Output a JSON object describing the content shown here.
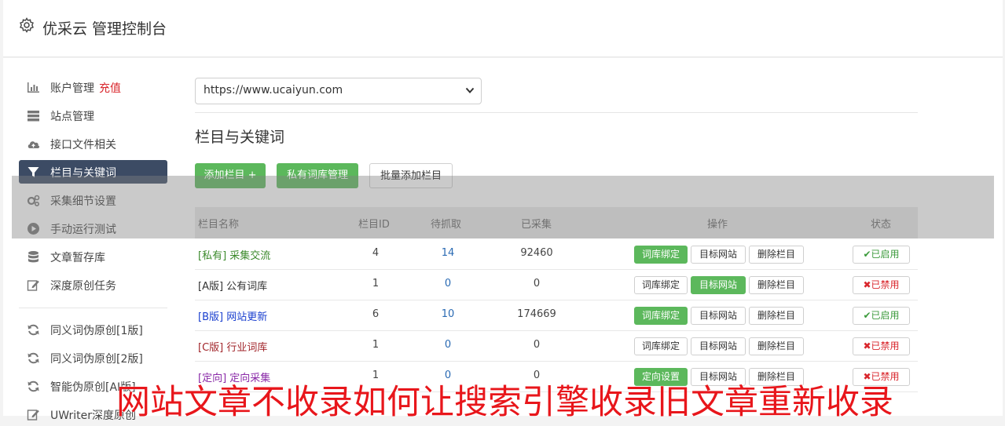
{
  "header": {
    "title": "优采云 管理控制台"
  },
  "sidebar": {
    "items": [
      {
        "label": "账户管理",
        "extra": "充值",
        "icon": "bar-chart-icon"
      },
      {
        "label": "站点管理",
        "icon": "server-icon"
      },
      {
        "label": "接口文件相关",
        "icon": "cloud-upload-icon"
      },
      {
        "label": "栏目与关键词",
        "icon": "filter-icon",
        "active": true
      },
      {
        "label": "采集细节设置",
        "icon": "cogs-icon"
      },
      {
        "label": "手动运行测试",
        "icon": "play-circle-icon"
      },
      {
        "label": "文章暂存库",
        "icon": "database-icon"
      },
      {
        "label": "深度原创任务",
        "icon": "edit-icon"
      },
      {
        "label": "同义词伪原创[1版]",
        "icon": "refresh-icon"
      },
      {
        "label": "同义词伪原创[2版]",
        "icon": "refresh-icon"
      },
      {
        "label": "智能伪原创[AI版]",
        "icon": "refresh-icon"
      },
      {
        "label": "UWriter深度原创",
        "icon": "edit-icon"
      }
    ]
  },
  "site_select": {
    "value": "https://www.ucaiyun.com"
  },
  "section_title": "栏目与关键词",
  "toolbar": {
    "add_label": "添加栏目 +",
    "private_label": "私有词库管理",
    "batch_label": "批量添加栏目"
  },
  "table": {
    "headers": {
      "name": "栏目名称",
      "id": "栏目ID",
      "wait": "待抓取",
      "done": "已采集",
      "ops": "操作",
      "status": "状态"
    },
    "rows": [
      {
        "name": "[私有] 采集交流",
        "id": "4",
        "wait": "14",
        "done": "92460",
        "op1": "词库绑定",
        "op2": "目标网站",
        "op3": "删除栏目",
        "status": "✔已启用"
      },
      {
        "name": "[A版] 公有词库",
        "id": "1",
        "wait": "0",
        "done": "0",
        "op1": "词库绑定",
        "op2": "目标网站",
        "op3": "删除栏目",
        "status": "✖已禁用"
      },
      {
        "name": "[B版] 网站更新",
        "id": "6",
        "wait": "10",
        "done": "174669",
        "op1": "词库绑定",
        "op2": "目标网站",
        "op3": "删除栏目",
        "status": "✔已启用"
      },
      {
        "name": "[C版] 行业词库",
        "id": "1",
        "wait": "0",
        "done": "0",
        "op1": "词库绑定",
        "op2": "目标网站",
        "op3": "删除栏目",
        "status": "✖已禁用"
      },
      {
        "name": "[定向] 定向采集",
        "id": "1",
        "wait": "0",
        "done": "0",
        "op1": "定向设置",
        "op2": "目标网站",
        "op3": "删除栏目",
        "status": "✖已禁用"
      }
    ]
  },
  "banner": "网站文章不收录如何让搜索引擎收录旧文章重新收录",
  "colors": {
    "green": "#5cb85c",
    "sidebar_active": "#3c4b64",
    "red": "#d9262c",
    "link_blue": "#2a6ab3"
  }
}
